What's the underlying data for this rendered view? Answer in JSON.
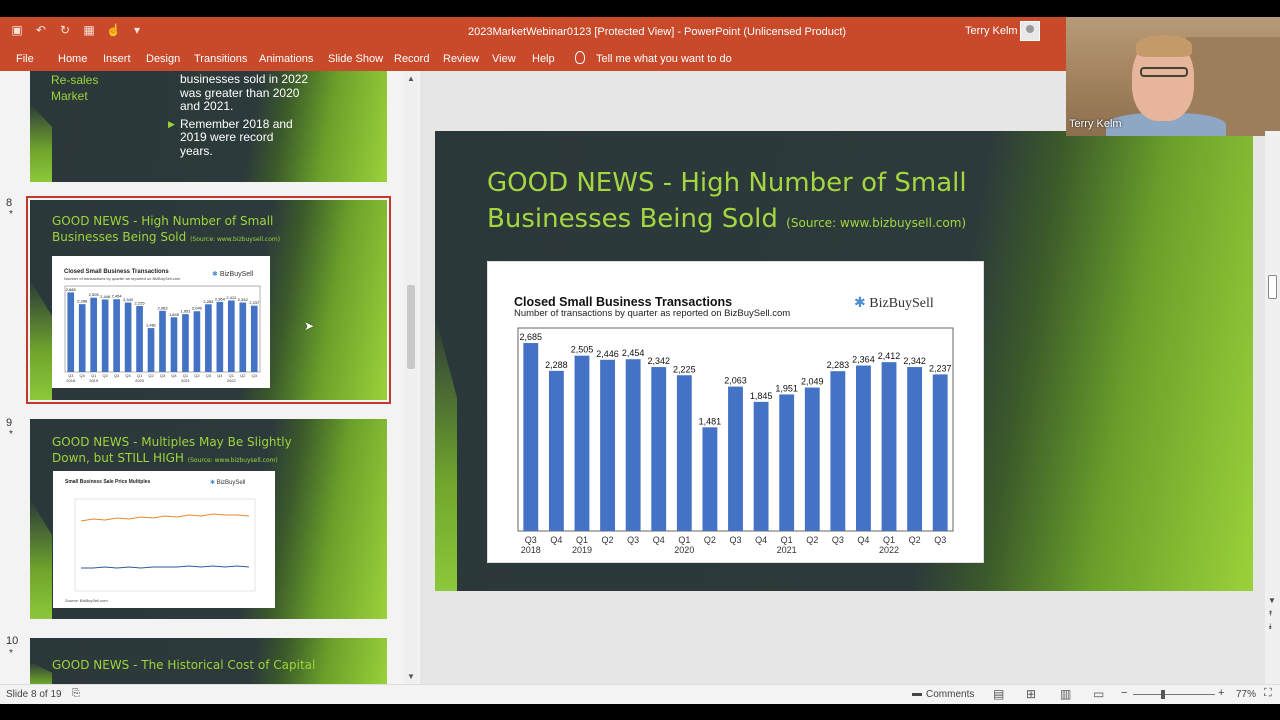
{
  "window": {
    "title": "2023MarketWebinar0123 [Protected View]  -  PowerPoint (Unlicensed Product)",
    "user": "Terry Kelm"
  },
  "ribbon": {
    "tabs": [
      "File",
      "Home",
      "Insert",
      "Design",
      "Transitions",
      "Animations",
      "Slide Show",
      "Record",
      "Review",
      "View",
      "Help"
    ],
    "tell_me": "Tell me what you want to do"
  },
  "thumbnails": {
    "slide7": {
      "left_label": "Re-sales\nMarket",
      "lines": [
        "businesses sold in 2022",
        "was greater than 2020",
        "and 2021.",
        "Remember 2018 and",
        "2019 were record",
        "years."
      ]
    },
    "slide8": {
      "number": "8",
      "star": "*",
      "title": "GOOD NEWS - High Number of Small Businesses Being Sold",
      "source": "(Source: www.bizbuysell.com)",
      "mini_title": "Closed Small Business Transactions",
      "mini_sub": "Number of transactions by quarter as reported on BizBuySell.com",
      "mini_brand": "BizBuySell"
    },
    "slide9": {
      "number": "9",
      "star": "*",
      "title": "GOOD NEWS - Multiples May Be Slightly Down, but STILL HIGH",
      "source": "(Source: www.bizbuysell.com)",
      "mini_title": "Small Business Sale Price Multiples",
      "mini_brand": "BizBuySell",
      "mini_foot": "Source: BizBuySell.com"
    },
    "slide10": {
      "number": "10",
      "star": "*",
      "title": "GOOD NEWS - The Historical Cost of Capital"
    }
  },
  "main_slide": {
    "title_line1": "GOOD NEWS - High Number of Small",
    "title_line2": "Businesses Being Sold",
    "source": "(Source: www.bizbuysell.com)"
  },
  "chart_data": {
    "type": "bar",
    "title": "Closed Small Business Transactions",
    "subtitle": "Number of transactions by quarter as reported on BizBuySell.com",
    "brand": "BizBuySell",
    "categories": [
      "Q3",
      "Q4",
      "Q1",
      "Q2",
      "Q3",
      "Q4",
      "Q1",
      "Q2",
      "Q3",
      "Q4",
      "Q1",
      "Q2",
      "Q3",
      "Q4",
      "Q1",
      "Q2",
      "Q3"
    ],
    "year_labels": [
      {
        "label": "2018",
        "index": 0
      },
      {
        "label": "2019",
        "index": 2
      },
      {
        "label": "2020",
        "index": 6
      },
      {
        "label": "2021",
        "index": 10
      },
      {
        "label": "2022",
        "index": 14
      }
    ],
    "values": [
      2685,
      2288,
      2505,
      2446,
      2454,
      2342,
      2225,
      1481,
      2063,
      1845,
      1951,
      2049,
      2283,
      2364,
      2412,
      2342,
      2237
    ],
    "value_labels": [
      "2,685",
      "2,288",
      "2,505",
      "2,446",
      "2,454",
      "2,342",
      "2,225",
      "1,481",
      "2,063",
      "1,845",
      "1,951",
      "2,049",
      "2,283",
      "2,364",
      "2,412",
      "2,342",
      "2,237"
    ],
    "ylim": [
      0,
      2900
    ],
    "bar_color": "#4472c4",
    "grid": false
  },
  "status": {
    "slide_info": "Slide 8 of 19",
    "comments": "Comments",
    "zoom": "77%"
  },
  "webcam": {
    "name": "Terry Kelm"
  },
  "colors": {
    "ribbon": "#c94a2b",
    "slide_title": "#a4d640",
    "slide_dark": "#2b3839",
    "selection": "#c0392b"
  }
}
